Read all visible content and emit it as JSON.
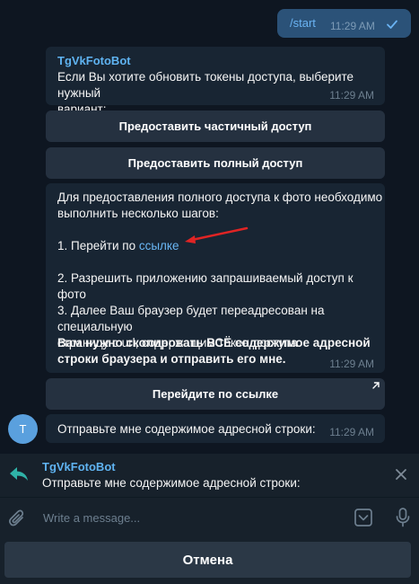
{
  "outgoing": {
    "text": "/start",
    "time": "11:29 AM"
  },
  "bot_message": {
    "sender": "TgVkFotoBot",
    "text": "Если Вы хотите обновить токены доступа, выберите нужный\nвариант:",
    "time": "11:29 AM"
  },
  "keyboard": {
    "partial_access": "Предоставить частичный доступ",
    "full_access": "Предоставить полный доступ"
  },
  "instructions": {
    "intro": "Для предоставления полного доступа к фото необходимо\nвыполнить несколько шагов:",
    "step1_prefix": "1. Перейти по ",
    "step1_link": "ссылке",
    "step2": "2. Разрешить приложению запрашиваемый доступ к фото",
    "step3": "3. Далее Ваш браузер будет переадресован на специальную\nстраницу с url, содержащим токен доступа.",
    "bold_note": "Вам нужно скопировать ВСЁ содержимое адресной\nстроки браузера и отправить его мне.",
    "time": "11:29 AM"
  },
  "link_button": "Перейдите по ссылке",
  "last_message": {
    "avatar_letter": "T",
    "text": "Отправьте мне содержимое адресной строки:",
    "time": "11:29 AM"
  },
  "reply_bar": {
    "title": "TgVkFotoBot",
    "text": "Отправьте мне содержимое адресной строки:"
  },
  "input": {
    "placeholder": "Write a message..."
  },
  "cancel_button": "Отмена",
  "colors": {
    "accent": "#5fb3f1",
    "outgoing_bubble": "#2b5278",
    "incoming_bubble": "#182533",
    "arrow": "#e02424"
  }
}
